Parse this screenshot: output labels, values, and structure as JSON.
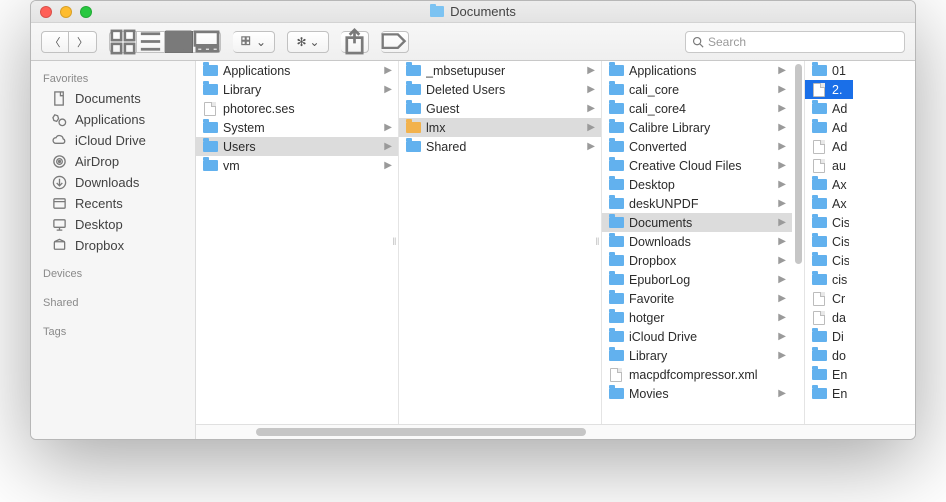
{
  "window": {
    "title": "Documents"
  },
  "toolbar": {
    "search_placeholder": "Search",
    "view_mode_active": "columns"
  },
  "sidebar": {
    "sections": [
      {
        "title": "Favorites",
        "items": [
          {
            "label": "Documents",
            "icon": "doc"
          },
          {
            "label": "Applications",
            "icon": "apps"
          },
          {
            "label": "iCloud Drive",
            "icon": "cloud"
          },
          {
            "label": "AirDrop",
            "icon": "airdrop"
          },
          {
            "label": "Downloads",
            "icon": "download"
          },
          {
            "label": "Recents",
            "icon": "recents"
          },
          {
            "label": "Desktop",
            "icon": "desktop"
          },
          {
            "label": "Dropbox",
            "icon": "dropbox"
          }
        ]
      },
      {
        "title": "Devices",
        "items": []
      },
      {
        "title": "Shared",
        "items": []
      },
      {
        "title": "Tags",
        "items": []
      }
    ]
  },
  "columns": [
    {
      "items": [
        {
          "label": "Applications",
          "type": "folder",
          "expandable": true
        },
        {
          "label": "Library",
          "type": "folder",
          "expandable": true
        },
        {
          "label": "photorec.ses",
          "type": "file",
          "expandable": false
        },
        {
          "label": "System",
          "type": "folder",
          "expandable": true
        },
        {
          "label": "Users",
          "type": "folder",
          "expandable": true,
          "selected": "grey"
        },
        {
          "label": "vm",
          "type": "folder",
          "expandable": true
        }
      ]
    },
    {
      "items": [
        {
          "label": "_mbsetupuser",
          "type": "folder",
          "expandable": true
        },
        {
          "label": "Deleted Users",
          "type": "folder",
          "expandable": true
        },
        {
          "label": "Guest",
          "type": "folder",
          "expandable": true
        },
        {
          "label": "lmx",
          "type": "home",
          "expandable": true,
          "selected": "grey"
        },
        {
          "label": "Shared",
          "type": "folder",
          "expandable": true
        }
      ]
    },
    {
      "scroll": true,
      "items": [
        {
          "label": "Applications",
          "type": "folder",
          "expandable": true
        },
        {
          "label": "cali_core",
          "type": "folder",
          "expandable": true
        },
        {
          "label": "cali_core4",
          "type": "folder",
          "expandable": true
        },
        {
          "label": "Calibre Library",
          "type": "folder",
          "expandable": true
        },
        {
          "label": "Converted",
          "type": "folder",
          "expandable": true
        },
        {
          "label": "Creative Cloud Files",
          "type": "folder",
          "expandable": true
        },
        {
          "label": "Desktop",
          "type": "folder",
          "expandable": true
        },
        {
          "label": "deskUNPDF",
          "type": "folder",
          "expandable": true
        },
        {
          "label": "Documents",
          "type": "folder",
          "expandable": true,
          "selected": "grey"
        },
        {
          "label": "Downloads",
          "type": "folder",
          "expandable": true
        },
        {
          "label": "Dropbox",
          "type": "folder",
          "expandable": true
        },
        {
          "label": "EpuborLog",
          "type": "folder",
          "expandable": true
        },
        {
          "label": "Favorite",
          "type": "folder",
          "expandable": true
        },
        {
          "label": "hotger",
          "type": "folder",
          "expandable": true
        },
        {
          "label": "iCloud Drive",
          "type": "folder",
          "expandable": true
        },
        {
          "label": "Library",
          "type": "folder",
          "expandable": true
        },
        {
          "label": "macpdfcompressor.xml",
          "type": "file",
          "expandable": false
        },
        {
          "label": "Movies",
          "type": "folder",
          "expandable": true
        }
      ]
    },
    {
      "clipped": true,
      "items": [
        {
          "label": "01",
          "type": "folder"
        },
        {
          "label": "2.",
          "type": "file",
          "selected": "blue"
        },
        {
          "label": "Ad",
          "type": "folder"
        },
        {
          "label": "Ad",
          "type": "folder"
        },
        {
          "label": "Ad",
          "type": "file"
        },
        {
          "label": "au",
          "type": "file"
        },
        {
          "label": "Ax",
          "type": "folder"
        },
        {
          "label": "Ax",
          "type": "folder"
        },
        {
          "label": "Cis",
          "type": "folder"
        },
        {
          "label": "Cis",
          "type": "folder"
        },
        {
          "label": "Cis",
          "type": "folder"
        },
        {
          "label": "cis",
          "type": "folder"
        },
        {
          "label": "Cr",
          "type": "file"
        },
        {
          "label": "da",
          "type": "file"
        },
        {
          "label": "Di",
          "type": "folder"
        },
        {
          "label": "do",
          "type": "folder"
        },
        {
          "label": "En",
          "type": "folder"
        },
        {
          "label": "En",
          "type": "folder"
        }
      ]
    }
  ]
}
